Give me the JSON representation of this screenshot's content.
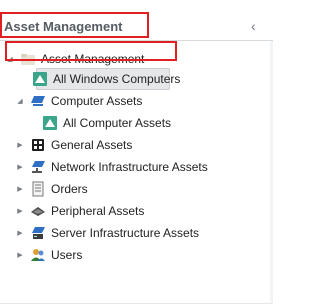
{
  "header": {
    "title": "Asset Management",
    "collapse_glyph": "‹"
  },
  "tree": {
    "root": {
      "label": "Asset Management",
      "icon": "folder-icon"
    },
    "all_windows": {
      "label": "All Windows Computers",
      "icon": "view-icon"
    },
    "computer_assets": {
      "label": "Computer Assets",
      "icon": "computer-icon"
    },
    "all_computer_assets": {
      "label": "All Computer Assets",
      "icon": "view-icon",
      "selected": true
    },
    "general_assets": {
      "label": "General Assets",
      "icon": "general-icon"
    },
    "network_assets": {
      "label": "Network Infrastructure Assets",
      "icon": "network-icon"
    },
    "orders": {
      "label": "Orders",
      "icon": "orders-icon"
    },
    "peripheral_assets": {
      "label": "Peripheral Assets",
      "icon": "peripheral-icon"
    },
    "server_assets": {
      "label": "Server Infrastructure Assets",
      "icon": "server-icon"
    },
    "users": {
      "label": "Users",
      "icon": "users-icon"
    }
  },
  "colors": {
    "highlight_border": "#e02020",
    "selection_bg": "#e6e7e9",
    "view_icon": "#3aa58a"
  }
}
